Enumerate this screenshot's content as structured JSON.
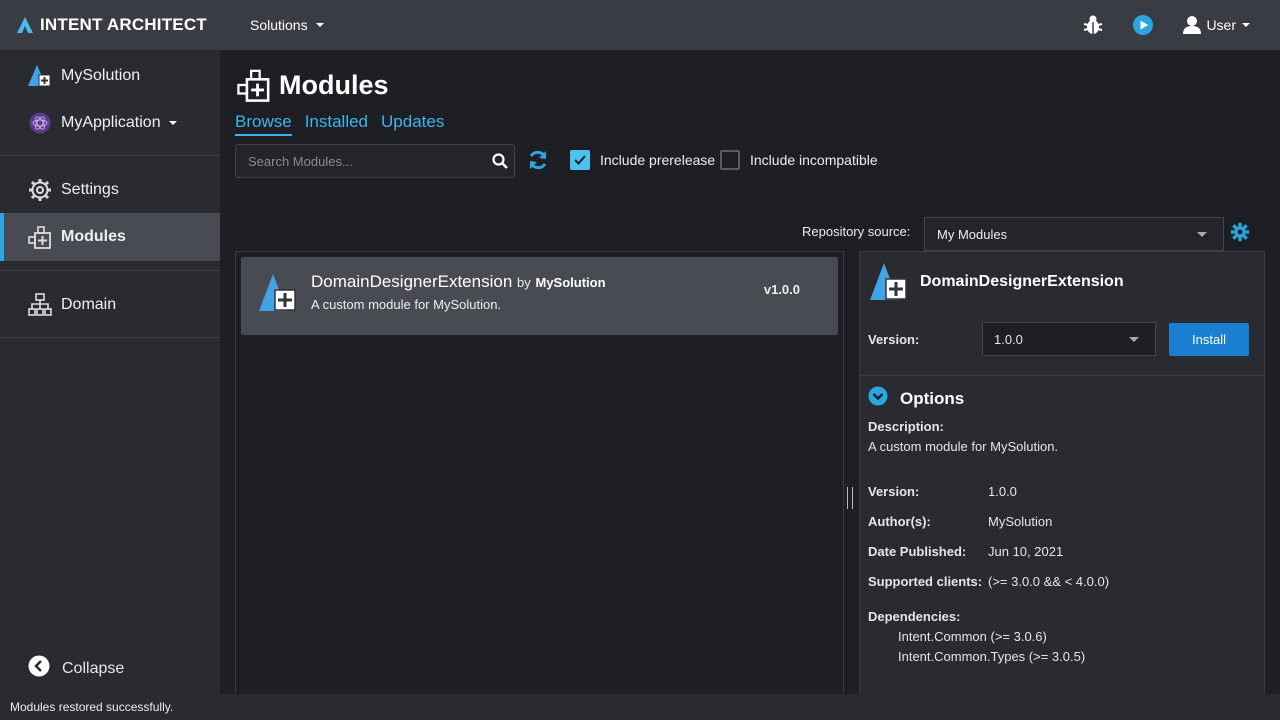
{
  "app": {
    "brand": "INTENT ARCHITECT"
  },
  "topbar": {
    "solutions_menu": "Solutions",
    "user_label": "User"
  },
  "sidebar": {
    "solution": "MySolution",
    "application": "MyApplication",
    "items": [
      {
        "label": "Settings",
        "icon": "gear-icon"
      },
      {
        "label": "Modules",
        "icon": "modules-icon",
        "active": true
      },
      {
        "label": "Domain",
        "icon": "hierarchy-icon"
      }
    ],
    "collapse": "Collapse"
  },
  "page": {
    "title": "Modules",
    "tabs": [
      "Browse",
      "Installed",
      "Updates"
    ],
    "search_placeholder": "Search Modules...",
    "include_prerelease": "Include prerelease",
    "include_prerelease_checked": true,
    "include_incompatible": "Include incompatible",
    "include_incompatible_checked": false,
    "repo_label": "Repository source:",
    "repo_value": "My Modules"
  },
  "modules": [
    {
      "name": "DomainDesignerExtension",
      "by": "by",
      "author": "MySolution",
      "description": "A custom module for MySolution.",
      "version": "v1.0.0"
    }
  ],
  "detail": {
    "name": "DomainDesignerExtension",
    "version_label": "Version:",
    "version_value": "1.0.0",
    "install": "Install",
    "options": "Options",
    "description_label": "Description:",
    "description": "A custom module for MySolution.",
    "fields": [
      {
        "k": "Version:",
        "v": "1.0.0"
      },
      {
        "k": "Author(s):",
        "v": "MySolution"
      },
      {
        "k": "Date Published:",
        "v": "Jun 10, 2021"
      },
      {
        "k": "Supported clients:",
        "v": "(>= 3.0.0 && < 4.0.0)"
      }
    ],
    "dependencies_label": "Dependencies:",
    "dependencies": [
      "Intent.Common (>= 3.0.6)",
      "Intent.Common.Types (>= 3.0.5)"
    ]
  },
  "status": "Modules restored successfully.",
  "colors": {
    "accent": "#3fb4ea",
    "install": "#1a7fd0",
    "active_item": "#494b53"
  }
}
